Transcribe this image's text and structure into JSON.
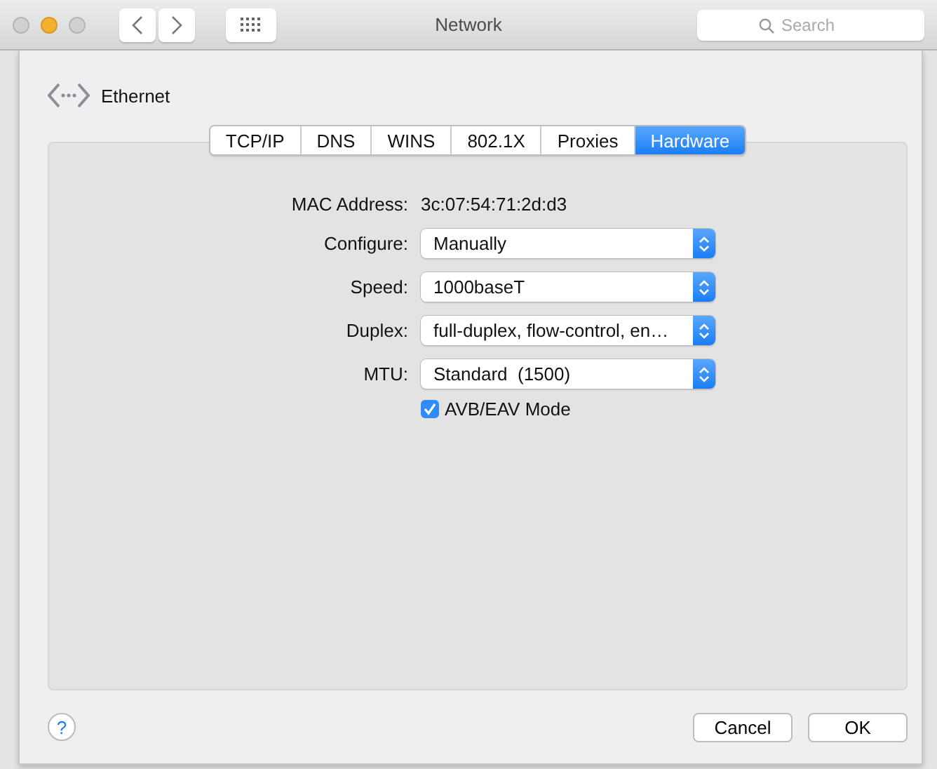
{
  "window": {
    "title": "Network",
    "lights": [
      {
        "color": "#d0d0d0"
      },
      {
        "color": "#f5b02e"
      },
      {
        "color": "#d0d0d0"
      }
    ]
  },
  "search": {
    "placeholder": "Search"
  },
  "interface": {
    "name": "Ethernet"
  },
  "tabs": [
    {
      "label": "TCP/IP",
      "selected": false
    },
    {
      "label": "DNS",
      "selected": false
    },
    {
      "label": "WINS",
      "selected": false
    },
    {
      "label": "802.1X",
      "selected": false
    },
    {
      "label": "Proxies",
      "selected": false
    },
    {
      "label": "Hardware",
      "selected": true
    }
  ],
  "mac": {
    "label": "MAC Address:",
    "value": "3c:07:54:71:2d:d3"
  },
  "fields": [
    {
      "label": "Configure:",
      "value": "Manually"
    },
    {
      "label": "Speed:",
      "value": "1000baseT"
    },
    {
      "label": "Duplex:",
      "value": "full-duplex, flow-control, en…"
    },
    {
      "label": "MTU:",
      "value": "Standard  (1500)"
    }
  ],
  "avb": {
    "label": "AVB/EAV Mode",
    "checked": true
  },
  "help": {
    "label": "?"
  },
  "buttons": [
    "Cancel",
    "OK"
  ]
}
